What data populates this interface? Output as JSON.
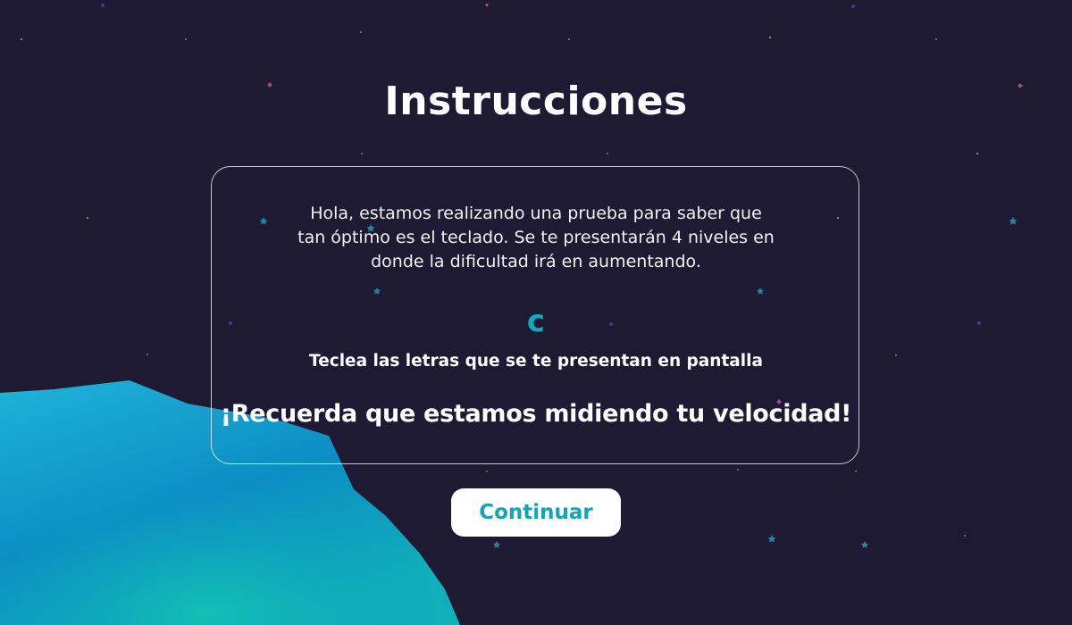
{
  "page": {
    "title": "Instrucciones",
    "intro_text": "Hola, estamos realizando una prueba para saber que tan óptimo es el teclado. Se te presentarán 4 niveles en donde la dificultad irá en aumentando.",
    "current_letter": "c",
    "instruction_text": "Teclea las letras que se te presentan en pantalla",
    "reminder_text": "¡Recuerda que estamos midiendo tu velocidad!",
    "continue_label": "Continuar"
  },
  "colors": {
    "background": "#1e1a33",
    "accent": "#12a9be",
    "button_bg": "#ffffff",
    "planet_light": "#1fb3d8",
    "planet_dark": "#0c8ec4",
    "planet_teal": "#10b3b8"
  },
  "decor": {
    "star_icons": [
      "star-icon",
      "sparkle-icon"
    ]
  }
}
